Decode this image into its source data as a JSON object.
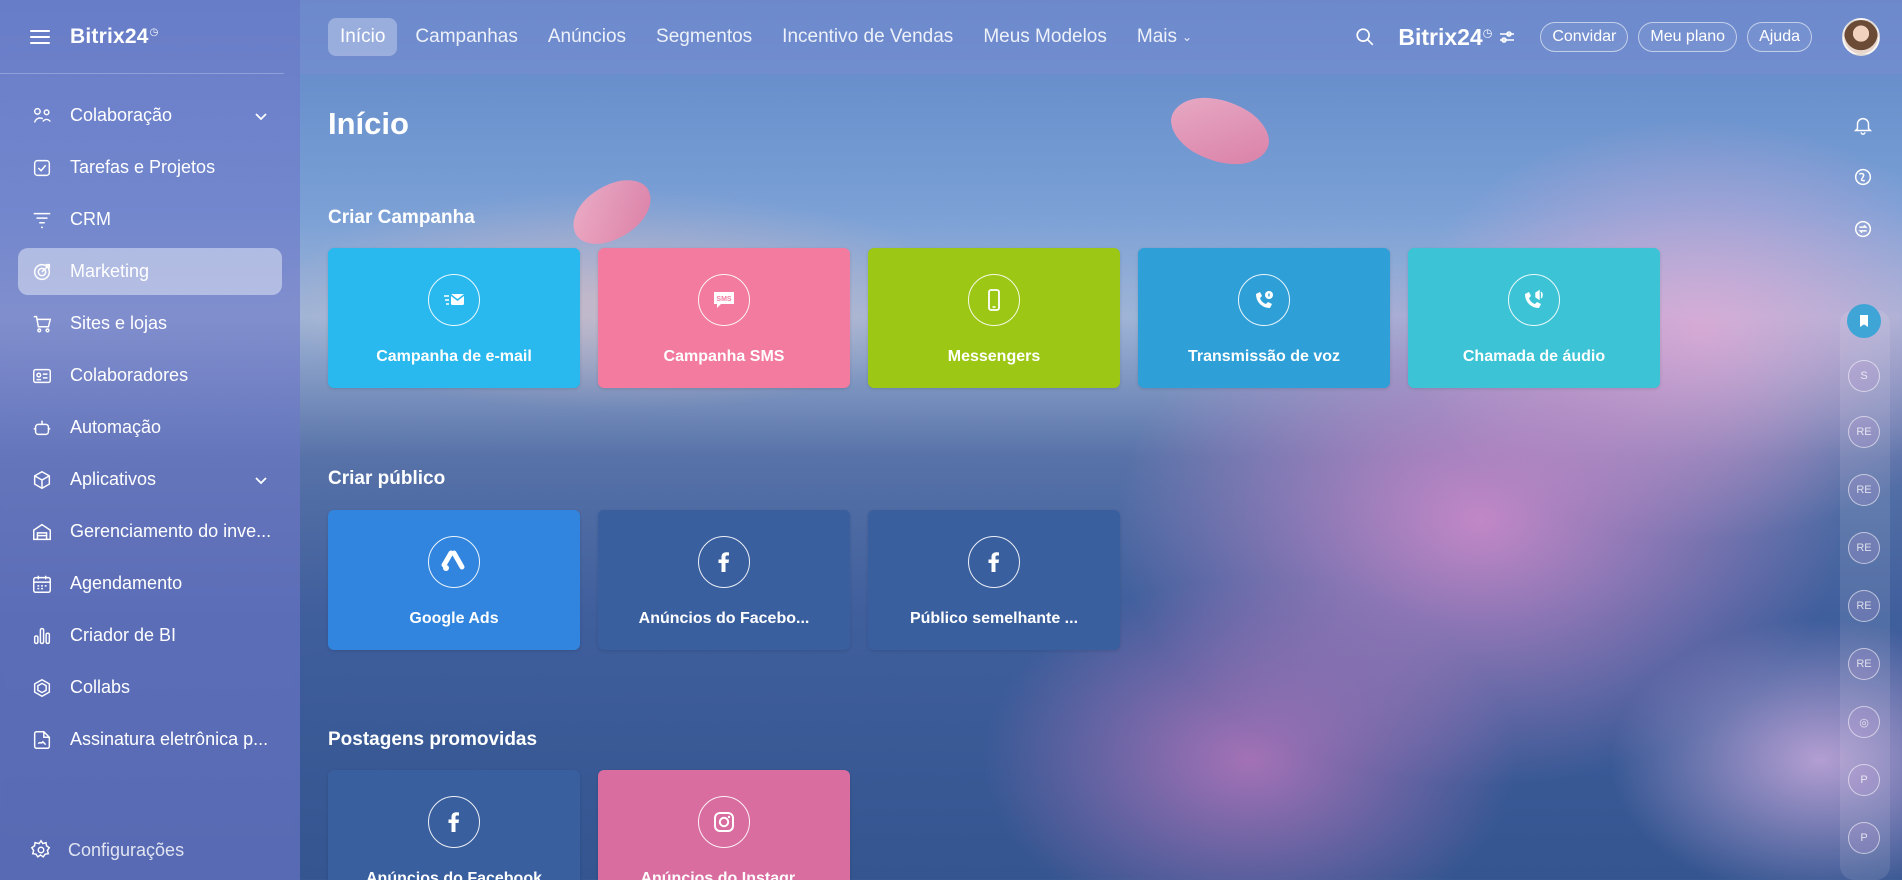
{
  "app": {
    "name": "Bitrix24"
  },
  "sidebar": {
    "logo": "Bitrix24",
    "items": [
      {
        "label": "Colaboração",
        "icon": "collaboration-icon",
        "expandable": true
      },
      {
        "label": "Tarefas e Projetos",
        "icon": "tasks-icon"
      },
      {
        "label": "CRM",
        "icon": "crm-icon"
      },
      {
        "label": "Marketing",
        "icon": "marketing-icon",
        "active": true
      },
      {
        "label": "Sites e lojas",
        "icon": "cart-icon"
      },
      {
        "label": "Colaboradores",
        "icon": "employees-icon"
      },
      {
        "label": "Automação",
        "icon": "automation-icon"
      },
      {
        "label": "Aplicativos",
        "icon": "apps-icon",
        "expandable": true
      },
      {
        "label": "Gerenciamento do inve...",
        "icon": "inventory-icon"
      },
      {
        "label": "Agendamento",
        "icon": "calendar-icon"
      },
      {
        "label": "Criador de BI",
        "icon": "bi-icon"
      },
      {
        "label": "Collabs",
        "icon": "collabs-icon"
      },
      {
        "label": "Assinatura eletrônica p...",
        "icon": "signature-icon"
      }
    ],
    "settings": "Configurações"
  },
  "topbar": {
    "tabs": [
      {
        "label": "Início",
        "active": true
      },
      {
        "label": "Campanhas"
      },
      {
        "label": "Anúncios"
      },
      {
        "label": "Segmentos"
      },
      {
        "label": "Incentivo de Vendas"
      },
      {
        "label": "Meus Modelos"
      },
      {
        "label": "Mais"
      }
    ],
    "brand": "Bitrix24",
    "buttons": {
      "invite": "Convidar",
      "plan": "Meu plano",
      "help": "Ajuda"
    }
  },
  "main": {
    "title": "Início",
    "sections": [
      {
        "title": "Criar Campanha",
        "tiles": [
          {
            "label": "Campanha de e-mail",
            "color": "#2ab9ee",
            "icon": "email-campaign-icon"
          },
          {
            "label": "Campanha SMS",
            "color": "#f27b9f",
            "icon": "sms-icon"
          },
          {
            "label": "Messengers",
            "color": "#9cc714",
            "icon": "phone-icon"
          },
          {
            "label": "Transmissão de voz",
            "color": "#2f9fd7",
            "icon": "voice-broadcast-icon"
          },
          {
            "label": "Chamada de áudio",
            "color": "#3cc4d6",
            "icon": "audio-call-icon"
          }
        ]
      },
      {
        "title": "Criar público",
        "tiles": [
          {
            "label": "Google Ads",
            "color": "#3185de",
            "icon": "google-ads-icon"
          },
          {
            "label": "Anúncios do Facebo...",
            "color": "#3a5f9e",
            "icon": "facebook-icon"
          },
          {
            "label": "Público semelhante ...",
            "color": "#3a5f9e",
            "icon": "facebook-icon"
          }
        ]
      },
      {
        "title": "Postagens promovidas",
        "tiles": [
          {
            "label": "Anúncios do Facebook",
            "color": "#3a5f9e",
            "icon": "facebook-icon"
          },
          {
            "label": "Anúncios do Instagr...",
            "color": "#d96da0",
            "icon": "instagram-icon"
          }
        ]
      }
    ]
  },
  "rail": {
    "chats": [
      "S",
      "RE",
      "RE",
      "RE",
      "RE",
      "RE",
      "P",
      "P"
    ]
  }
}
